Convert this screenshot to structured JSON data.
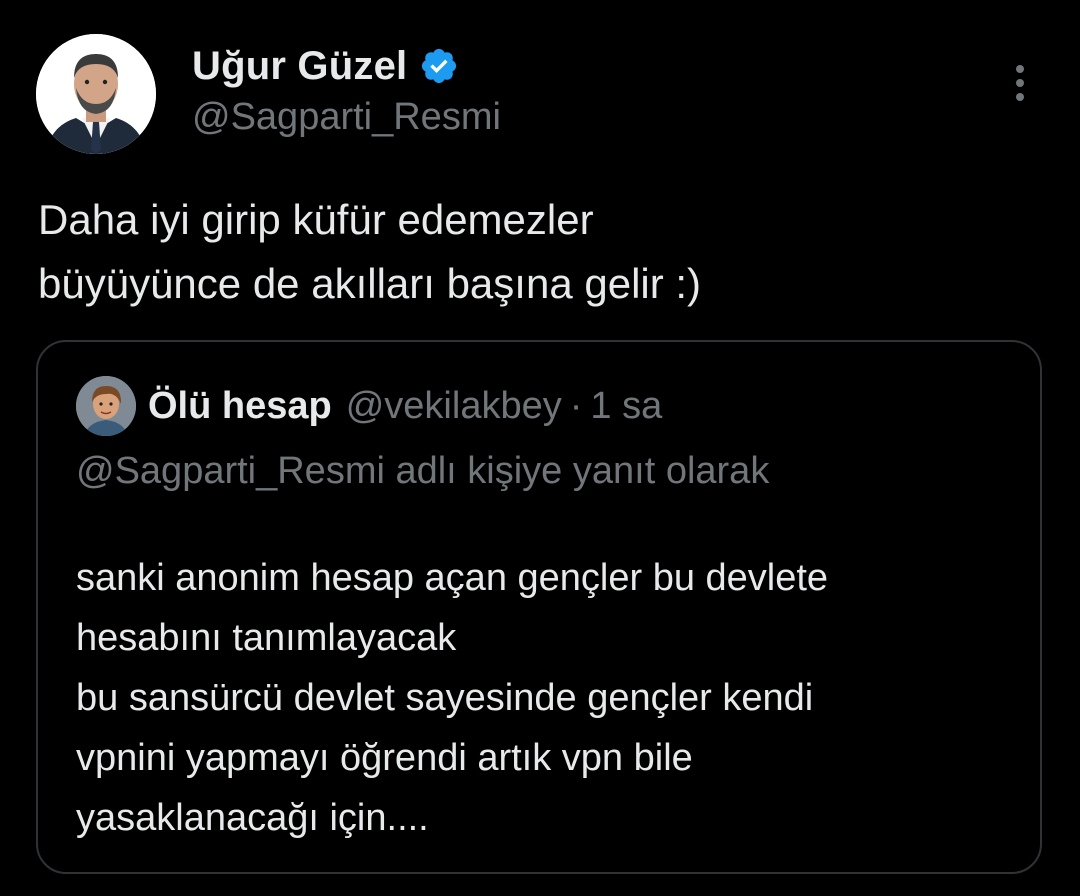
{
  "tweet": {
    "author": {
      "display_name": "Uğur Güzel",
      "handle": "@Sagparti_Resmi",
      "verified": true,
      "verified_color": "#1d9bf0"
    },
    "text": "Daha iyi girip küfür edemezler\nbüyüyünce de akılları başına gelir :)",
    "more_icon": "more-vertical-icon"
  },
  "quoted_tweet": {
    "author": {
      "display_name": "Ölü hesap",
      "handle": "@vekilakbey"
    },
    "separator": "·",
    "time": "1 sa",
    "reply_context": "@Sagparti_Resmi adlı kişiye yanıt olarak",
    "text": "sanki anonim hesap açan gençler bu devlete\nhesabını tanımlayacak\nbu sansürcü devlet sayesinde gençler kendi\nvpnini yapmayı öğrendi artık vpn bile\nyasaklanacağı için...."
  },
  "colors": {
    "background": "#000000",
    "text_primary": "#e7e9ea",
    "text_secondary": "#71767b",
    "border": "#2f3336"
  }
}
